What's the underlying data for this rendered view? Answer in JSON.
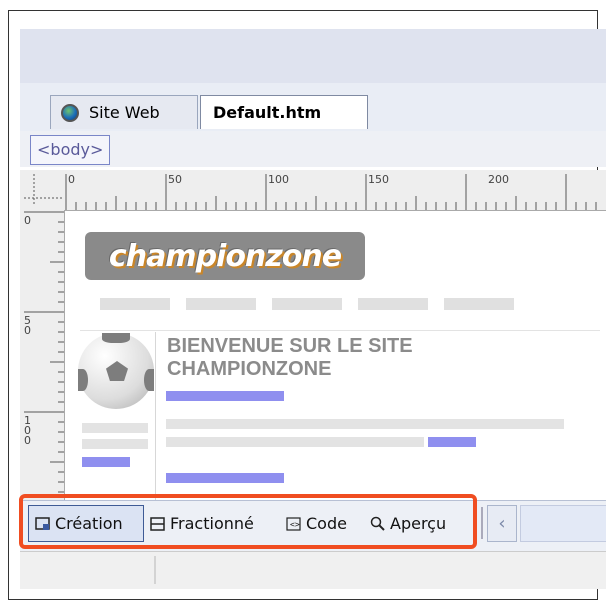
{
  "tabs": [
    {
      "label": "Site Web",
      "icon": "globe-icon"
    },
    {
      "label": "Default.htm"
    }
  ],
  "tag_selector": {
    "label": "<body>"
  },
  "ruler": {
    "h_labels": [
      "0",
      "50",
      "100",
      "150",
      "200"
    ],
    "v_labels": [
      "0",
      "5\n0",
      "1\n0\n0"
    ]
  },
  "page": {
    "logo": "championzone",
    "welcome_line1": "BIENVENUE SUR LE SITE",
    "welcome_line2": "CHAMPIONZONE"
  },
  "view_buttons": [
    {
      "label": "Création",
      "icon": "design-view-icon",
      "selected": true
    },
    {
      "label": "Fractionné",
      "icon": "split-view-icon"
    },
    {
      "label": "Code",
      "icon": "code-view-icon"
    },
    {
      "label": "Aperçu",
      "icon": "magnifier-icon"
    }
  ],
  "scroll": {
    "left_icon": "chevron-left-icon"
  },
  "colors": {
    "highlight": "#f04d21",
    "accent_bar": "#8f8fef",
    "selected_bg": "#dbe3f3"
  }
}
